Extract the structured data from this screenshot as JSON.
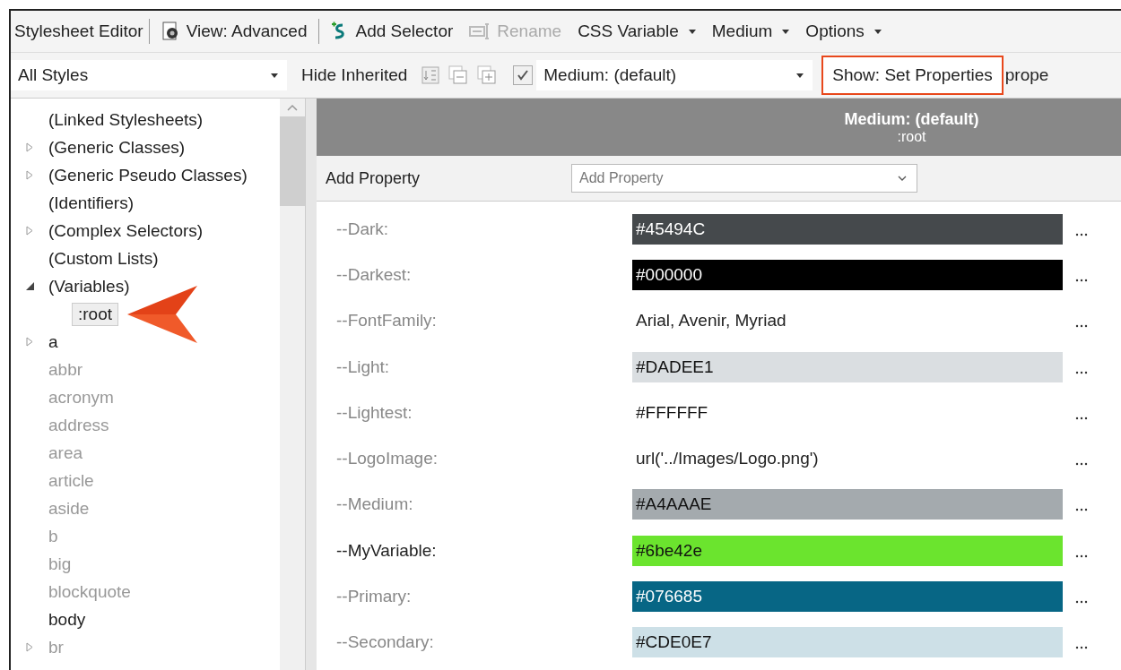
{
  "toolbar": {
    "title": "Stylesheet Editor",
    "items": [
      {
        "kind": "view",
        "label": "View: Advanced",
        "disabled": false,
        "menu": false
      },
      {
        "kind": "add",
        "label": "Add Selector",
        "disabled": false,
        "menu": false
      },
      {
        "kind": "rename",
        "label": "Rename",
        "disabled": true,
        "menu": false
      },
      {
        "kind": "text",
        "label": "CSS Variable",
        "disabled": false,
        "menu": true
      },
      {
        "kind": "text",
        "label": "Medium",
        "disabled": false,
        "menu": true
      },
      {
        "kind": "text",
        "label": "Options",
        "disabled": false,
        "menu": true
      }
    ]
  },
  "filter_bar": {
    "styles_dropdown": "All Styles",
    "hide_inherited": "Hide Inherited",
    "medium_checked": true,
    "medium_dropdown": "Medium: (default)",
    "show_dropdown": {
      "label": "Show: Set Properties",
      "highlighted": true
    },
    "cut_text": "prope"
  },
  "tree": [
    {
      "label": "(Linked Stylesheets)",
      "kind": "leaf",
      "dimmed": false
    },
    {
      "label": "(Generic Classes)",
      "kind": "branch",
      "expanded": false,
      "dimmed": false
    },
    {
      "label": "(Generic Pseudo Classes)",
      "kind": "branch",
      "expanded": false,
      "dimmed": false
    },
    {
      "label": "(Identifiers)",
      "kind": "leaf",
      "dimmed": false
    },
    {
      "label": "(Complex Selectors)",
      "kind": "branch",
      "expanded": false,
      "dimmed": false
    },
    {
      "label": "(Custom Lists)",
      "kind": "leaf",
      "dimmed": false
    },
    {
      "label": "(Variables)",
      "kind": "branch",
      "expanded": true,
      "dimmed": false,
      "children": [
        {
          "label": ":root",
          "selected": true
        }
      ]
    },
    {
      "label": "a",
      "kind": "branch",
      "expanded": false,
      "dimmed": false
    },
    {
      "label": "abbr",
      "kind": "leaf",
      "dimmed": true
    },
    {
      "label": "acronym",
      "kind": "leaf",
      "dimmed": true
    },
    {
      "label": "address",
      "kind": "leaf",
      "dimmed": true
    },
    {
      "label": "area",
      "kind": "leaf",
      "dimmed": true
    },
    {
      "label": "article",
      "kind": "leaf",
      "dimmed": true
    },
    {
      "label": "aside",
      "kind": "leaf",
      "dimmed": true
    },
    {
      "label": "b",
      "kind": "leaf",
      "dimmed": true
    },
    {
      "label": "big",
      "kind": "leaf",
      "dimmed": true
    },
    {
      "label": "blockquote",
      "kind": "leaf",
      "dimmed": true
    },
    {
      "label": "body",
      "kind": "leaf",
      "dimmed": false
    },
    {
      "label": "br",
      "kind": "branch",
      "expanded": false,
      "dimmed": true
    }
  ],
  "properties_header": {
    "medium": "Medium: (default)",
    "selector": ":root"
  },
  "add_property": {
    "label": "Add Property",
    "placeholder": "Add Property"
  },
  "properties": [
    {
      "name": "--Dark:",
      "value": "#45494C",
      "kind": "color",
      "color": "#45494c",
      "modified": false
    },
    {
      "name": "--Darkest:",
      "value": "#000000",
      "kind": "color",
      "color": "#000000",
      "modified": false
    },
    {
      "name": "--FontFamily:",
      "value": "Arial, Avenir, Myriad",
      "kind": "text",
      "modified": false
    },
    {
      "name": "--Light:",
      "value": "#DADEE1",
      "kind": "color",
      "color": "#dadee1",
      "modified": false
    },
    {
      "name": "--Lightest:",
      "value": "#FFFFFF",
      "kind": "color",
      "color": "#ffffff",
      "modified": false
    },
    {
      "name": "--LogoImage:",
      "value": "url('../Images/Logo.png')",
      "kind": "text",
      "modified": false
    },
    {
      "name": "--Medium:",
      "value": "#A4AAAE",
      "kind": "color",
      "color": "#a4aaae",
      "modified": false
    },
    {
      "name": "--MyVariable:",
      "value": "#6be42e",
      "kind": "color",
      "color": "#6be42e",
      "modified": true
    },
    {
      "name": "--Primary:",
      "value": "#076685",
      "kind": "color",
      "color": "#076685",
      "modified": false
    },
    {
      "name": "--Secondary:",
      "value": "#CDE0E7",
      "kind": "color",
      "color": "#cde0e7",
      "modified": false
    }
  ]
}
